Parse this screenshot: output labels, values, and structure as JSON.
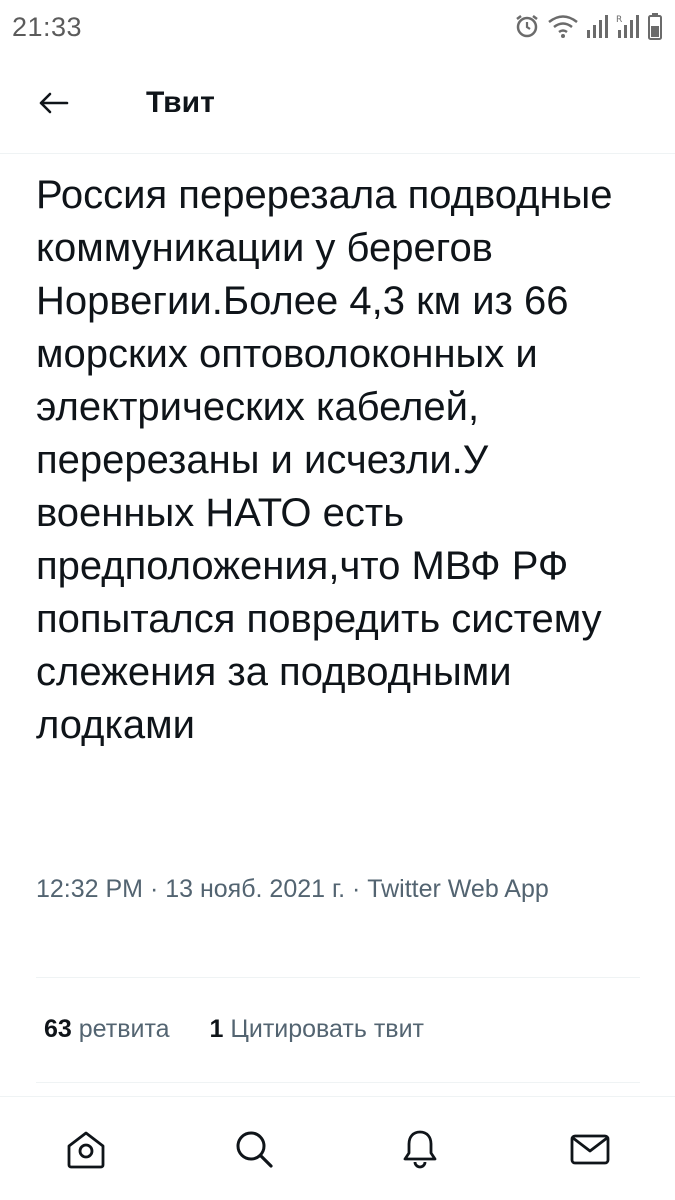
{
  "status_bar": {
    "time": "21:33",
    "icons": [
      "alarm-icon",
      "wifi-icon",
      "signal-icon",
      "signal-roaming-icon",
      "battery-icon"
    ]
  },
  "header": {
    "back_icon": "arrow-left-icon",
    "title": "Твит"
  },
  "tweet": {
    "text": "Россия перерезала подводные коммуникации у берегов Норвегии.Более 4,3 км из 66 морских оптоволоконных и электрических кабелей, перерезаны и исчезли.У военных НАТО есть предположения,что МВФ РФ попытался повредить систему слежения за подводными лодками",
    "timestamp": "12:32 PM · 13 нояб. 2021 г. · Twitter Web App"
  },
  "stats": {
    "retweets_count": "63",
    "retweets_label": "ретвита",
    "quotes_count": "1",
    "quotes_label": "Цитировать твит"
  },
  "bottom_nav": {
    "items": [
      "home-icon",
      "search-icon",
      "notifications-bell-icon",
      "messages-envelope-icon"
    ]
  },
  "colors": {
    "text": "#0f1419",
    "secondary": "#536471",
    "divider": "#eff3f4"
  }
}
